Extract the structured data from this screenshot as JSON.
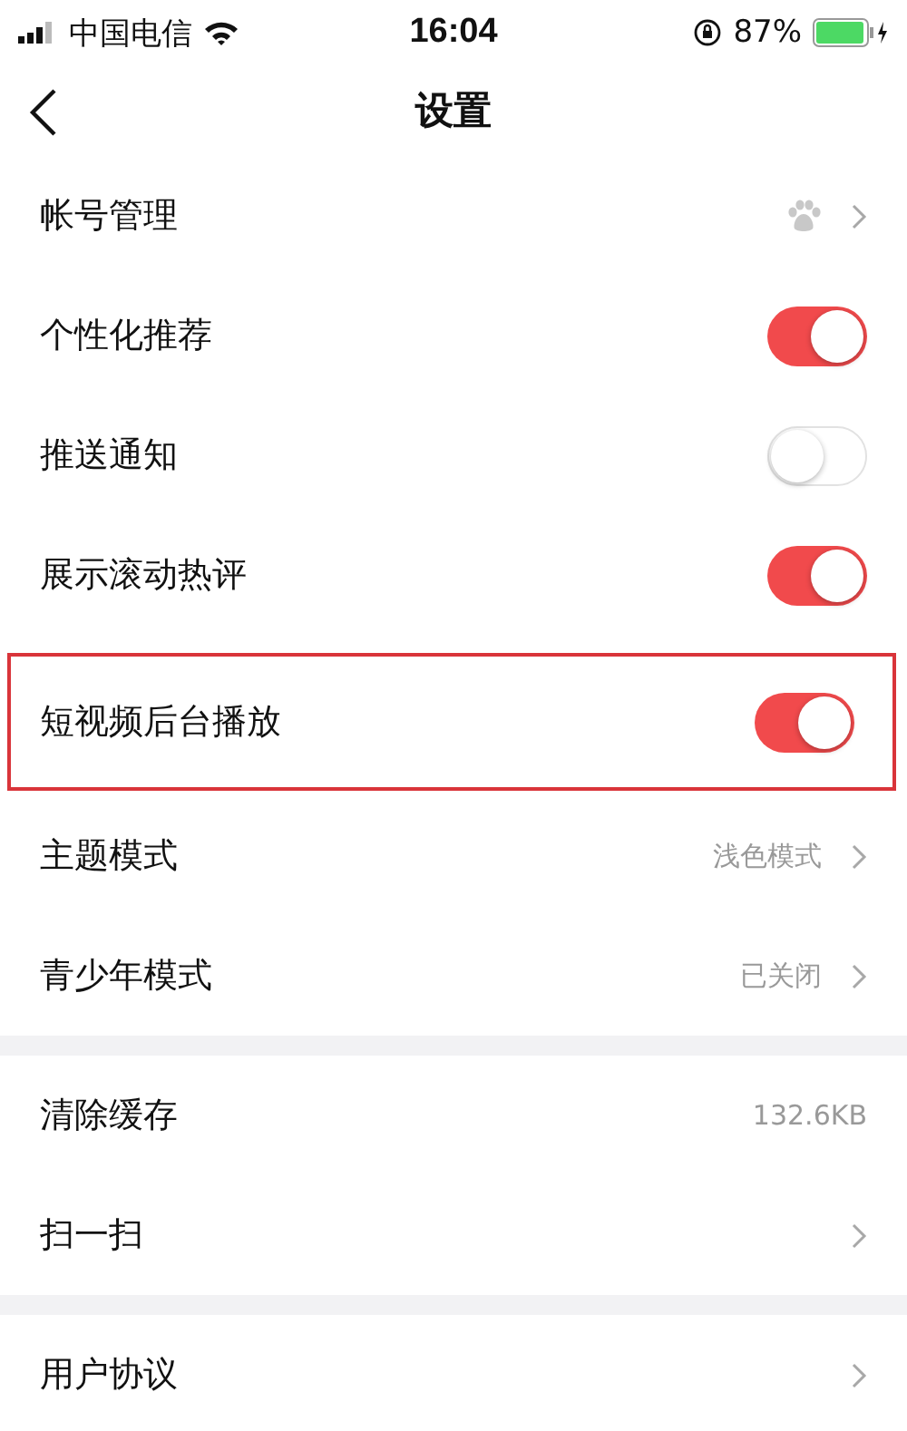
{
  "status_bar": {
    "carrier": "中国电信",
    "time": "16:04",
    "battery": "87%"
  },
  "nav": {
    "title": "设置"
  },
  "sections": [
    {
      "rows": [
        {
          "kind": "account",
          "label": "帐号管理",
          "highlighted": false
        },
        {
          "kind": "toggle",
          "label": "个性化推荐",
          "on": true,
          "highlighted": false
        },
        {
          "kind": "toggle",
          "label": "推送通知",
          "on": false,
          "highlighted": false
        },
        {
          "kind": "toggle",
          "label": "展示滚动热评",
          "on": true,
          "highlighted": false
        },
        {
          "kind": "toggle",
          "label": "短视频后台播放",
          "on": true,
          "highlighted": true
        },
        {
          "kind": "link",
          "label": "主题模式",
          "value": "浅色模式",
          "highlighted": false
        },
        {
          "kind": "link",
          "label": "青少年模式",
          "value": "已关闭",
          "highlighted": false
        }
      ]
    },
    {
      "rows": [
        {
          "kind": "info",
          "label": "清除缓存",
          "value": "132.6KB",
          "highlighted": false
        },
        {
          "kind": "link",
          "label": "扫一扫",
          "highlighted": false
        }
      ]
    },
    {
      "rows": [
        {
          "kind": "link",
          "label": "用户协议",
          "highlighted": false
        }
      ]
    }
  ]
}
